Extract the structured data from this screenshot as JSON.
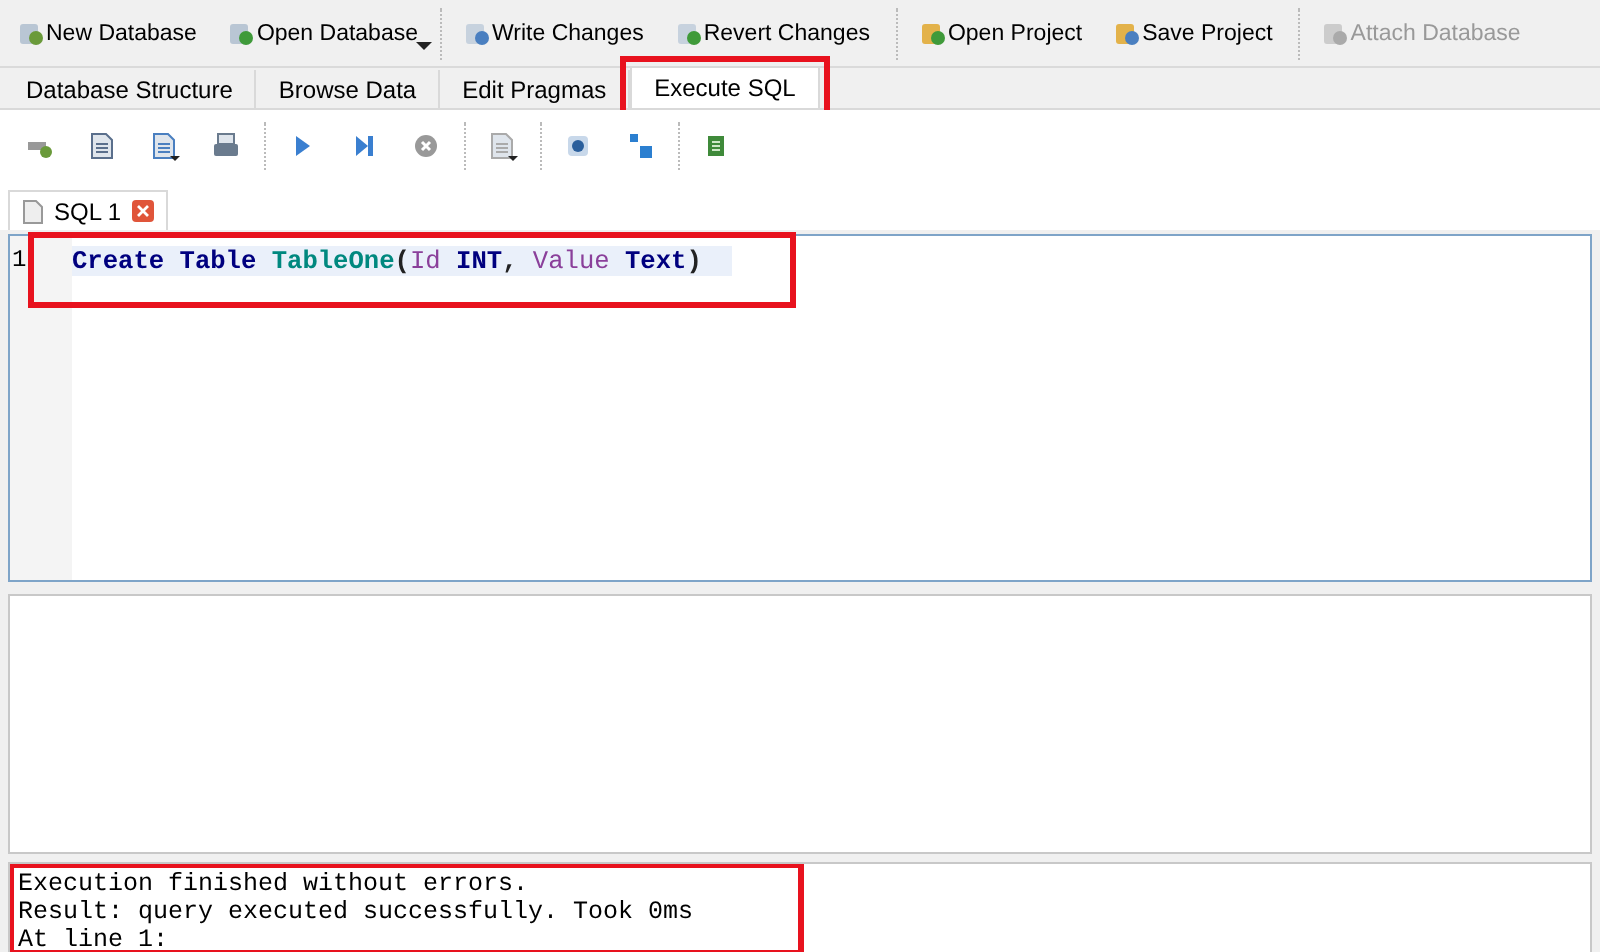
{
  "main_toolbar": [
    {
      "label": "New Database",
      "disabled": false
    },
    {
      "label": "Open Database",
      "disabled": false
    },
    {
      "label": "Write Changes",
      "disabled": false
    },
    {
      "label": "Revert Changes",
      "disabled": false
    },
    {
      "label": "Open Project",
      "disabled": false
    },
    {
      "label": "Save Project",
      "disabled": false
    },
    {
      "label": "Attach Database",
      "disabled": true
    }
  ],
  "tabs": [
    {
      "label": "Database Structure",
      "selected": false,
      "annotated": false
    },
    {
      "label": "Browse Data",
      "selected": false,
      "annotated": false
    },
    {
      "label": "Edit Pragmas",
      "selected": false,
      "annotated": false
    },
    {
      "label": "Execute SQL",
      "selected": true,
      "annotated": true
    }
  ],
  "editor_tabs": [
    {
      "label": "SQL 1"
    }
  ],
  "editor": {
    "annotated": true,
    "lines": [
      {
        "number": "1",
        "tokens": [
          {
            "text": "Create ",
            "kind": "keyword"
          },
          {
            "text": "Table ",
            "kind": "keyword"
          },
          {
            "text": "TableOne",
            "kind": "table"
          },
          {
            "text": "(",
            "kind": "plain"
          },
          {
            "text": "Id ",
            "kind": "column"
          },
          {
            "text": "INT",
            "kind": "keyword"
          },
          {
            "text": ", ",
            "kind": "plain"
          },
          {
            "text": "Value ",
            "kind": "column"
          },
          {
            "text": "Text",
            "kind": "keyword"
          },
          {
            "text": ")",
            "kind": "plain"
          }
        ]
      }
    ]
  },
  "output": {
    "annotated": true,
    "lines": [
      "Execution finished without errors.",
      "Result: query executed successfully. Took 0ms",
      "At line 1:"
    ]
  }
}
